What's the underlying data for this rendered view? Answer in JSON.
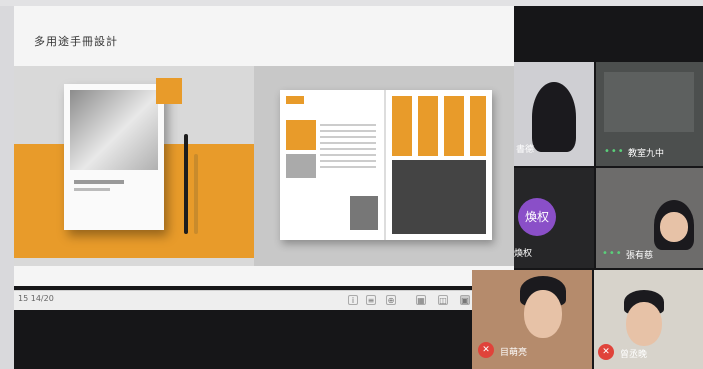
{
  "slide": {
    "title": "多用途手冊設計",
    "page_counter": "15 14/20",
    "controls": [
      "info-icon",
      "notes-icon",
      "zoom-icon",
      "grid-view-icon",
      "split-view-icon",
      "fit-view-icon",
      "fullscreen-icon"
    ]
  },
  "participants": [
    {
      "name": "書德",
      "video": "camera-on",
      "muted": null
    },
    {
      "name": "教室九中",
      "video": "camera-on",
      "speaking_dots": "•••"
    },
    {
      "name": "煥权",
      "video": "avatar",
      "avatar_text": "煥权"
    },
    {
      "name": "張有慈",
      "video": "camera-on",
      "speaking_dots": "•••"
    },
    {
      "name": "目萌亮",
      "video": "camera-on",
      "muted": "true"
    },
    {
      "name": "曾丞晚",
      "video": "camera-on",
      "muted": "true"
    }
  ],
  "colors": {
    "accent_orange": "#e89b2a",
    "avatar_purple": "#8a4fc8",
    "mute_red": "#e0433a",
    "speaking_green": "#5ad07a"
  }
}
